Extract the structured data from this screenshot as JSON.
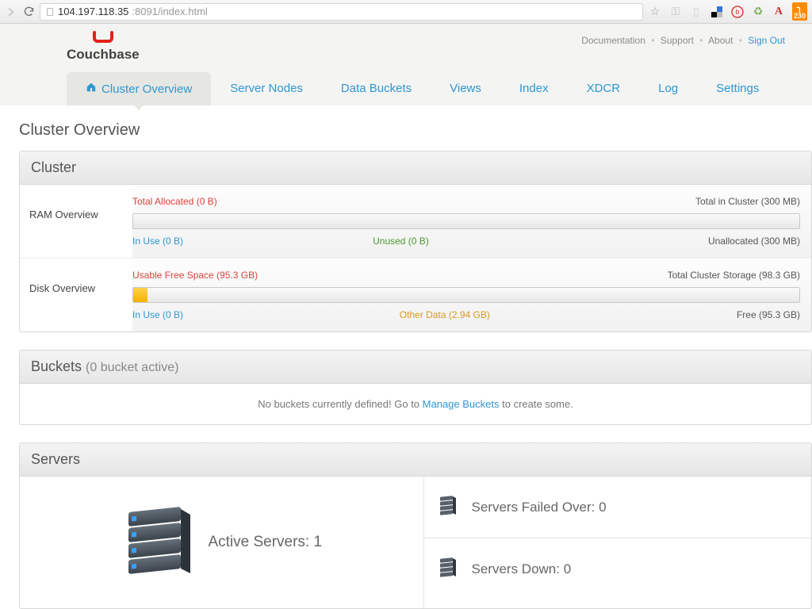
{
  "browser": {
    "url_host": "104.197.118.35",
    "url_port_path": ":8091/index.html",
    "rss_badge": "230"
  },
  "header": {
    "brand": "Couchbase",
    "links": {
      "doc": "Documentation",
      "support": "Support",
      "about": "About",
      "signout": "Sign Out"
    }
  },
  "nav": {
    "items": [
      "Cluster Overview",
      "Server Nodes",
      "Data Buckets",
      "Views",
      "Index",
      "XDCR",
      "Log",
      "Settings"
    ],
    "active_index": 0
  },
  "page_title": "Cluster Overview",
  "cluster": {
    "heading": "Cluster",
    "ram": {
      "label": "RAM Overview",
      "top_left": "Total Allocated (0 B)",
      "top_right": "Total in Cluster (300 MB)",
      "bot_left": "In Use (0 B)",
      "bot_mid": "Unused (0 B)",
      "bot_right": "Unallocated (300 MB)"
    },
    "disk": {
      "label": "Disk Overview",
      "top_left": "Usable Free Space (95.3 GB)",
      "top_right": "Total Cluster Storage (98.3 GB)",
      "bot_left": "In Use (0 B)",
      "bot_mid": "Other Data (2.94 GB)",
      "bot_right": "Free (95.3 GB)"
    }
  },
  "buckets": {
    "heading": "Buckets",
    "heading_sub": "(0 bucket active)",
    "msg_pre": "No buckets currently defined! Go to ",
    "msg_link": "Manage Buckets",
    "msg_post": " to create some."
  },
  "servers": {
    "heading": "Servers",
    "active": {
      "label": "Active Servers: ",
      "value": "1"
    },
    "failed": {
      "label": "Servers Failed Over: ",
      "value": "0"
    },
    "down": {
      "label": "Servers Down: ",
      "value": "0"
    }
  }
}
